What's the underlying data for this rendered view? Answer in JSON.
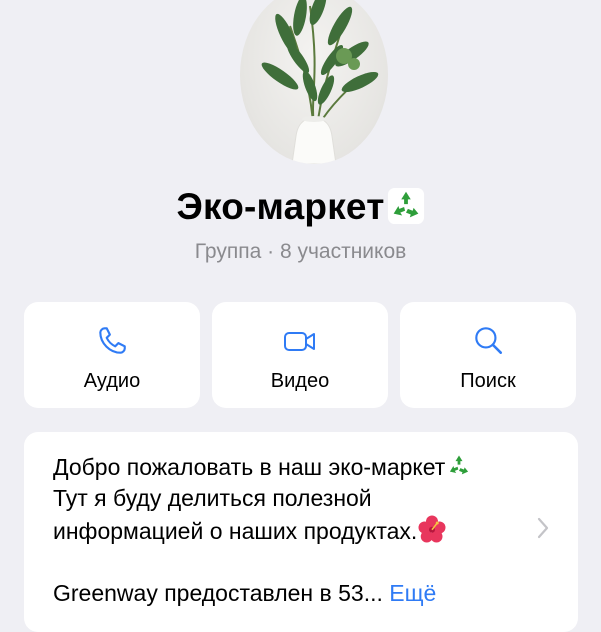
{
  "profile": {
    "name": "Эко-маркет",
    "subtitle": "Группа · 8 участников",
    "avatar_icon": "plant-photo"
  },
  "actions": [
    {
      "label": "Аудио",
      "icon": "phone-icon"
    },
    {
      "label": "Видео",
      "icon": "video-camera-icon"
    },
    {
      "label": "Поиск",
      "icon": "search-icon"
    }
  ],
  "description": {
    "line1": "Добро пожаловать в наш эко-маркет",
    "line2": "Тут я буду делиться полезной",
    "line3": "информацией о наших продуктах.",
    "line4": "Greenway предоставлен в 53...",
    "more": "Ещё"
  },
  "colors": {
    "accent": "#2f7bf5",
    "background": "#efeff4",
    "subtitle": "#8a8a8e",
    "recycle": "#2e9e3a"
  }
}
